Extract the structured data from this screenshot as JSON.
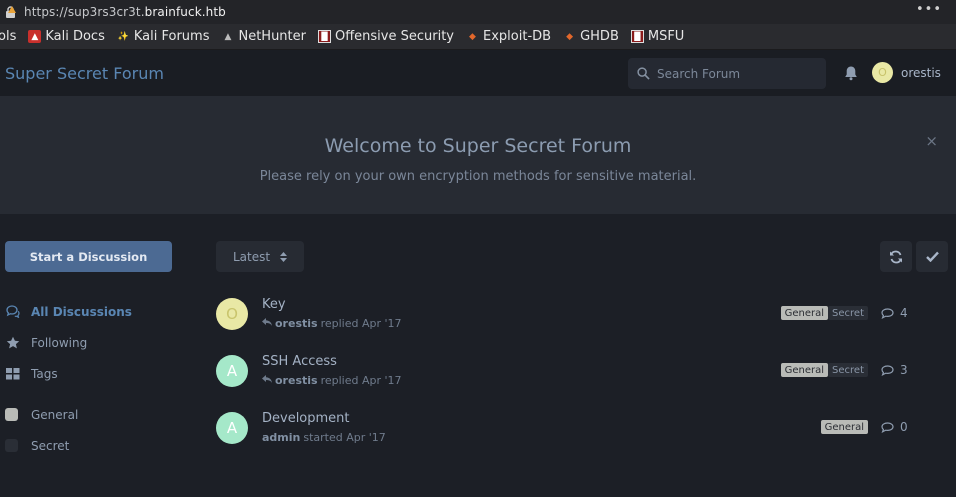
{
  "browser": {
    "url_prefix": "https://sup3rs3cr3t.",
    "url_host": "brainfuck.htb",
    "menu": "•••",
    "bookmarks": [
      {
        "label": "ols",
        "icon": "none"
      },
      {
        "label": "Kali Docs",
        "icon": "kali-docs-icon"
      },
      {
        "label": "Kali Forums",
        "icon": "kali-forums-icon"
      },
      {
        "label": "NetHunter",
        "icon": "nethunter-icon"
      },
      {
        "label": "Offensive Security",
        "icon": "offsec-icon"
      },
      {
        "label": "Exploit-DB",
        "icon": "exploitdb-icon"
      },
      {
        "label": "GHDB",
        "icon": "ghdb-icon"
      },
      {
        "label": "MSFU",
        "icon": "msfu-icon"
      }
    ]
  },
  "header": {
    "brand": "Super Secret Forum",
    "search_placeholder": "Search Forum",
    "username": "orestis",
    "avatar_letter": "O"
  },
  "hero": {
    "title": "Welcome to Super Secret Forum",
    "subtitle": "Please rely on your own encryption methods for sensitive material.",
    "close": "×"
  },
  "sidebar": {
    "start_button": "Start a Discussion",
    "nav": [
      {
        "label": "All Discussions",
        "icon": "comments-icon",
        "active": true
      },
      {
        "label": "Following",
        "icon": "star-icon",
        "active": false
      },
      {
        "label": "Tags",
        "icon": "tags-icon",
        "active": false
      }
    ],
    "tags": [
      {
        "label": "General",
        "color": "#b9bbb7"
      },
      {
        "label": "Secret",
        "color": "#2a2e36"
      }
    ]
  },
  "toolbar": {
    "sort_label": "Latest"
  },
  "discussions": [
    {
      "avatar_letter": "O",
      "avatar_color": "#e9e8a5",
      "avatar_text_color": "#c9c46c",
      "title": "Key",
      "user": "orestis",
      "action": "replied Apr '17",
      "reply": true,
      "tags": [
        "General",
        "Secret"
      ],
      "count": "4"
    },
    {
      "avatar_letter": "A",
      "avatar_color": "#a5e8c9",
      "avatar_text_color": "#ffffff",
      "title": "SSH Access",
      "user": "orestis",
      "action": "replied Apr '17",
      "reply": true,
      "tags": [
        "General",
        "Secret"
      ],
      "count": "3"
    },
    {
      "avatar_letter": "A",
      "avatar_color": "#a5e8c9",
      "avatar_text_color": "#ffffff",
      "title": "Development",
      "user": "admin",
      "action": "started Apr '17",
      "reply": false,
      "tags": [
        "General"
      ],
      "count": "0"
    }
  ]
}
